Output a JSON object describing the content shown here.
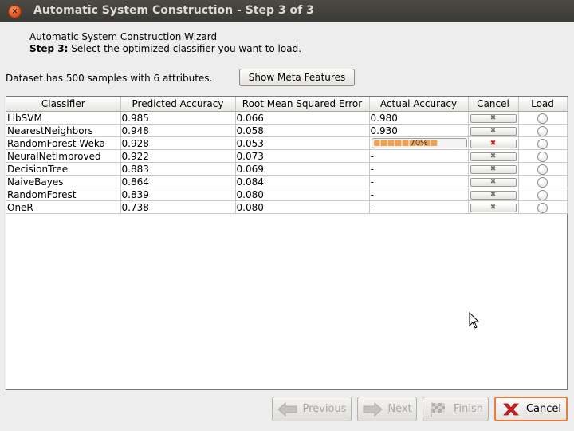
{
  "window": {
    "title": "Automatic System Construction - Step 3 of 3",
    "close_glyph": "×"
  },
  "header": {
    "wizard_name": "Automatic System Construction Wizard",
    "step_label": "Step 3:",
    "step_text": " Select the optimized classifier you want to load."
  },
  "dataset": {
    "info": "Dataset has 500 samples with 6 attributes.",
    "meta_button": "Show Meta Features"
  },
  "table": {
    "columns": [
      "Classifier",
      "Predicted Accuracy",
      "Root Mean Squared Error",
      "Actual Accuracy",
      "Cancel",
      "Load"
    ],
    "rows": [
      {
        "classifier": "LibSVM",
        "predicted": "0.985",
        "rmse": "0.066",
        "actual": "0.980",
        "cancel_icon": "x-icon",
        "cancel_active": false,
        "load_selected": false
      },
      {
        "classifier": "NearestNeighbors",
        "predicted": "0.948",
        "rmse": "0.058",
        "actual": "0.930",
        "cancel_icon": "x-icon",
        "cancel_active": false,
        "load_selected": false
      },
      {
        "classifier": "RandomForest-Weka",
        "predicted": "0.928",
        "rmse": "0.053",
        "actual": "70%",
        "actual_progress": 0.7,
        "cancel_icon": "x-icon",
        "cancel_active": true,
        "load_selected": false
      },
      {
        "classifier": "NeuralNetImproved",
        "predicted": "0.922",
        "rmse": "0.073",
        "actual": "-",
        "cancel_icon": "x-icon",
        "cancel_active": false,
        "load_selected": false
      },
      {
        "classifier": "DecisionTree",
        "predicted": "0.883",
        "rmse": "0.069",
        "actual": "-",
        "cancel_icon": "x-icon",
        "cancel_active": false,
        "load_selected": false
      },
      {
        "classifier": "NaiveBayes",
        "predicted": "0.864",
        "rmse": "0.084",
        "actual": "-",
        "cancel_icon": "x-icon",
        "cancel_active": false,
        "load_selected": false
      },
      {
        "classifier": "RandomForest",
        "predicted": "0.839",
        "rmse": "0.080",
        "actual": "-",
        "cancel_icon": "x-icon",
        "cancel_active": false,
        "load_selected": false
      },
      {
        "classifier": "OneR",
        "predicted": "0.738",
        "rmse": "0.080",
        "actual": "-",
        "cancel_icon": "x-icon",
        "cancel_active": false,
        "load_selected": false
      }
    ]
  },
  "buttons": {
    "previous": {
      "mnemonic": "P",
      "rest": "revious",
      "icon": "arrow-left-icon",
      "enabled": false
    },
    "next": {
      "mnemonic": "N",
      "rest": "ext",
      "icon": "arrow-right-icon",
      "enabled": false
    },
    "finish": {
      "mnemonic": "F",
      "rest": "inish",
      "icon": "checkered-flag-icon",
      "enabled": false
    },
    "cancel": {
      "mnemonic": "C",
      "rest": "ancel",
      "icon": "red-x-icon",
      "enabled": true
    }
  },
  "colors": {
    "titlebar": "#3c3b37",
    "close_button": "#dd4814",
    "progress": "#f0a050",
    "cancel_border": "#e77a3c",
    "cancel_x_active": "#cc1a1a"
  }
}
